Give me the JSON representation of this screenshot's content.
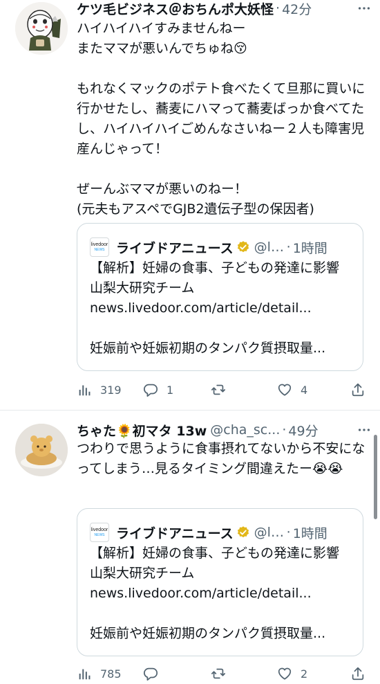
{
  "tweets": [
    {
      "display_name": "ケツ毛ビジネス＠おちんポ大妖怪",
      "handle": "",
      "time": "42分",
      "text": "ハイハイハイすみませんねー\nまたママが悪いんでちゅね😚\n\nもれなくマックのポテト食べたくて旦那に買いに行かせたし、蕎麦にハマって蕎麦ばっか食べてたし、ハイハイハイごめんなさいねー２人も障害児産んじゃって！\n\nぜーんぶママが悪いのねー！\n(元夫もアスペでGJB2遺伝子型の保因者)",
      "quote": {
        "logo_top": "livedoor",
        "logo_bottom": "NEWS",
        "name": "ライブドアニュース",
        "handle": "@livedoornews",
        "time": "1時間",
        "text": "【解析】妊婦の食事、子どもの発達に影響 山梨大研究チーム\nnews.livedoor.com/article/detail...\n\n妊娠前や妊娠初期のタンパク質摂取量..."
      },
      "stats": {
        "views": "319",
        "replies": "1",
        "retweets": "",
        "likes": "4"
      }
    },
    {
      "display_name": "ちゃた🌻初マタ 13w",
      "handle": "@cha_sc...",
      "time": "49分",
      "text": "つわりで思うように食事摂れてないから不安になってしまう…見るタイミング間違えたー😭😭",
      "quote": {
        "logo_top": "livedoor",
        "logo_bottom": "NEWS",
        "name": "ライブドアニュース",
        "handle": "@livedoornews",
        "time": "1時間",
        "text": "【解析】妊婦の食事、子どもの発達に影響 山梨大研究チーム\nnews.livedoor.com/article/detail...\n\n妊娠前や妊娠初期のタンパク質摂取量..."
      },
      "stats": {
        "views": "785",
        "replies": "",
        "retweets": "",
        "likes": "2"
      }
    }
  ],
  "ui": {
    "dot": "·"
  },
  "icons": {
    "more": "more-icon",
    "views": "views-icon",
    "reply": "reply-icon",
    "retweet": "retweet-icon",
    "like": "like-icon",
    "share": "share-icon",
    "verified": "verified-badge-icon"
  },
  "colors": {
    "text": "#0f1419",
    "secondary": "#536471",
    "border": "#cfd9de",
    "verified": "#e2b719"
  }
}
